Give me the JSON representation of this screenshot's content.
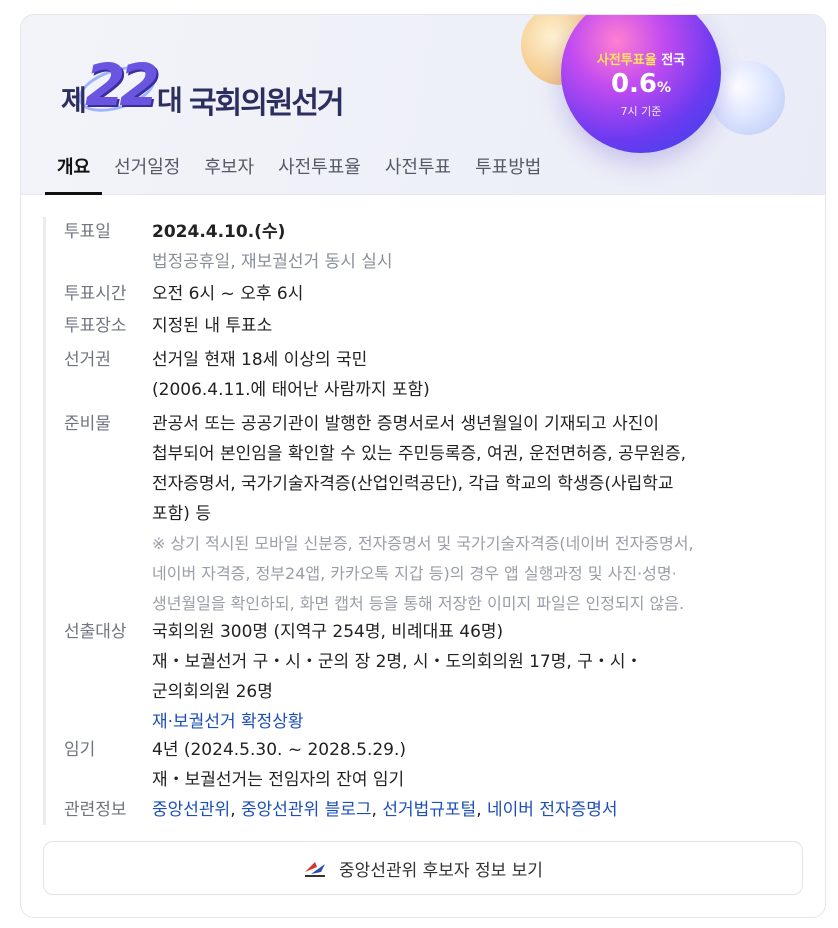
{
  "banner": {
    "logo": {
      "prefix": "제",
      "number": "22",
      "suffix": "대",
      "title": "국회의원선거"
    },
    "turnout": {
      "label_highlight": "사전투표율",
      "label_rest": " 전국",
      "value": "0.6",
      "unit": "%",
      "sub": "7시 기준"
    }
  },
  "tabs": [
    "개요",
    "선거일정",
    "후보자",
    "사전투표율",
    "사전투표",
    "투표방법"
  ],
  "rows": {
    "vote_day": {
      "label": "투표일",
      "date": "2024.4.10.(수)",
      "sub": "법정공휴일, 재보궐선거 동시 실시"
    },
    "vote_time": {
      "label": "투표시간",
      "value": "오전 6시 ~ 오후 6시"
    },
    "vote_place": {
      "label": "투표장소",
      "value": "지정된 내 투표소"
    },
    "suffrage": {
      "label": "선거권",
      "line1": "선거일 현재 18세 이상의 국민",
      "line2": "(2006.4.11.에 태어난 사람까지 포함)"
    },
    "prepare": {
      "label": "준비물",
      "lines": [
        "관공서 또는 공공기관이 발행한 증명서로서 생년월일이 기재되고 사진이",
        "첩부되어 본인임을 확인할 수 있는 주민등록증, 여권, 운전면허증, 공무원증,",
        "전자증명서, 국가기술자격증(산업인력공단), 각급 학교의 학생증(사립학교",
        "포함) 등"
      ],
      "notes": [
        "※ 상기 적시된 모바일 신분증, 전자증명서 및 국가기술자격증(네이버 전자증명서,",
        "네이버 자격증, 정부24앱, 카카오톡 지갑 등)의 경우 앱 실행과정 및 사진·성명·",
        "생년월일을 확인하되, 화면 캡처 등을 통해 저장한 이미지 파일은 인정되지 않음."
      ]
    },
    "targets": {
      "label": "선출대상",
      "lines": [
        "국회의원 300명 (지역구 254명, 비례대표 46명)",
        "재・보궐선거 구・시・군의 장 2명, 시・도의회의원 17명, 구・시・",
        "군의회의원 26명"
      ],
      "link": "재·보궐선거 확정상황"
    },
    "term": {
      "label": "임기",
      "line1": "4년 (2024.5.30. ~ 2028.5.29.)",
      "line2": "재・보궐선거는 전임자의 잔여 임기"
    },
    "related": {
      "label": "관련정보",
      "links": [
        "중앙선관위",
        "중앙선관위 블로그",
        "선거법규포털",
        "네이버 전자증명서"
      ],
      "separator": ", "
    }
  },
  "button": {
    "label": "중앙선관위 후보자 정보 보기",
    "icon": "nec-logo-icon"
  }
}
